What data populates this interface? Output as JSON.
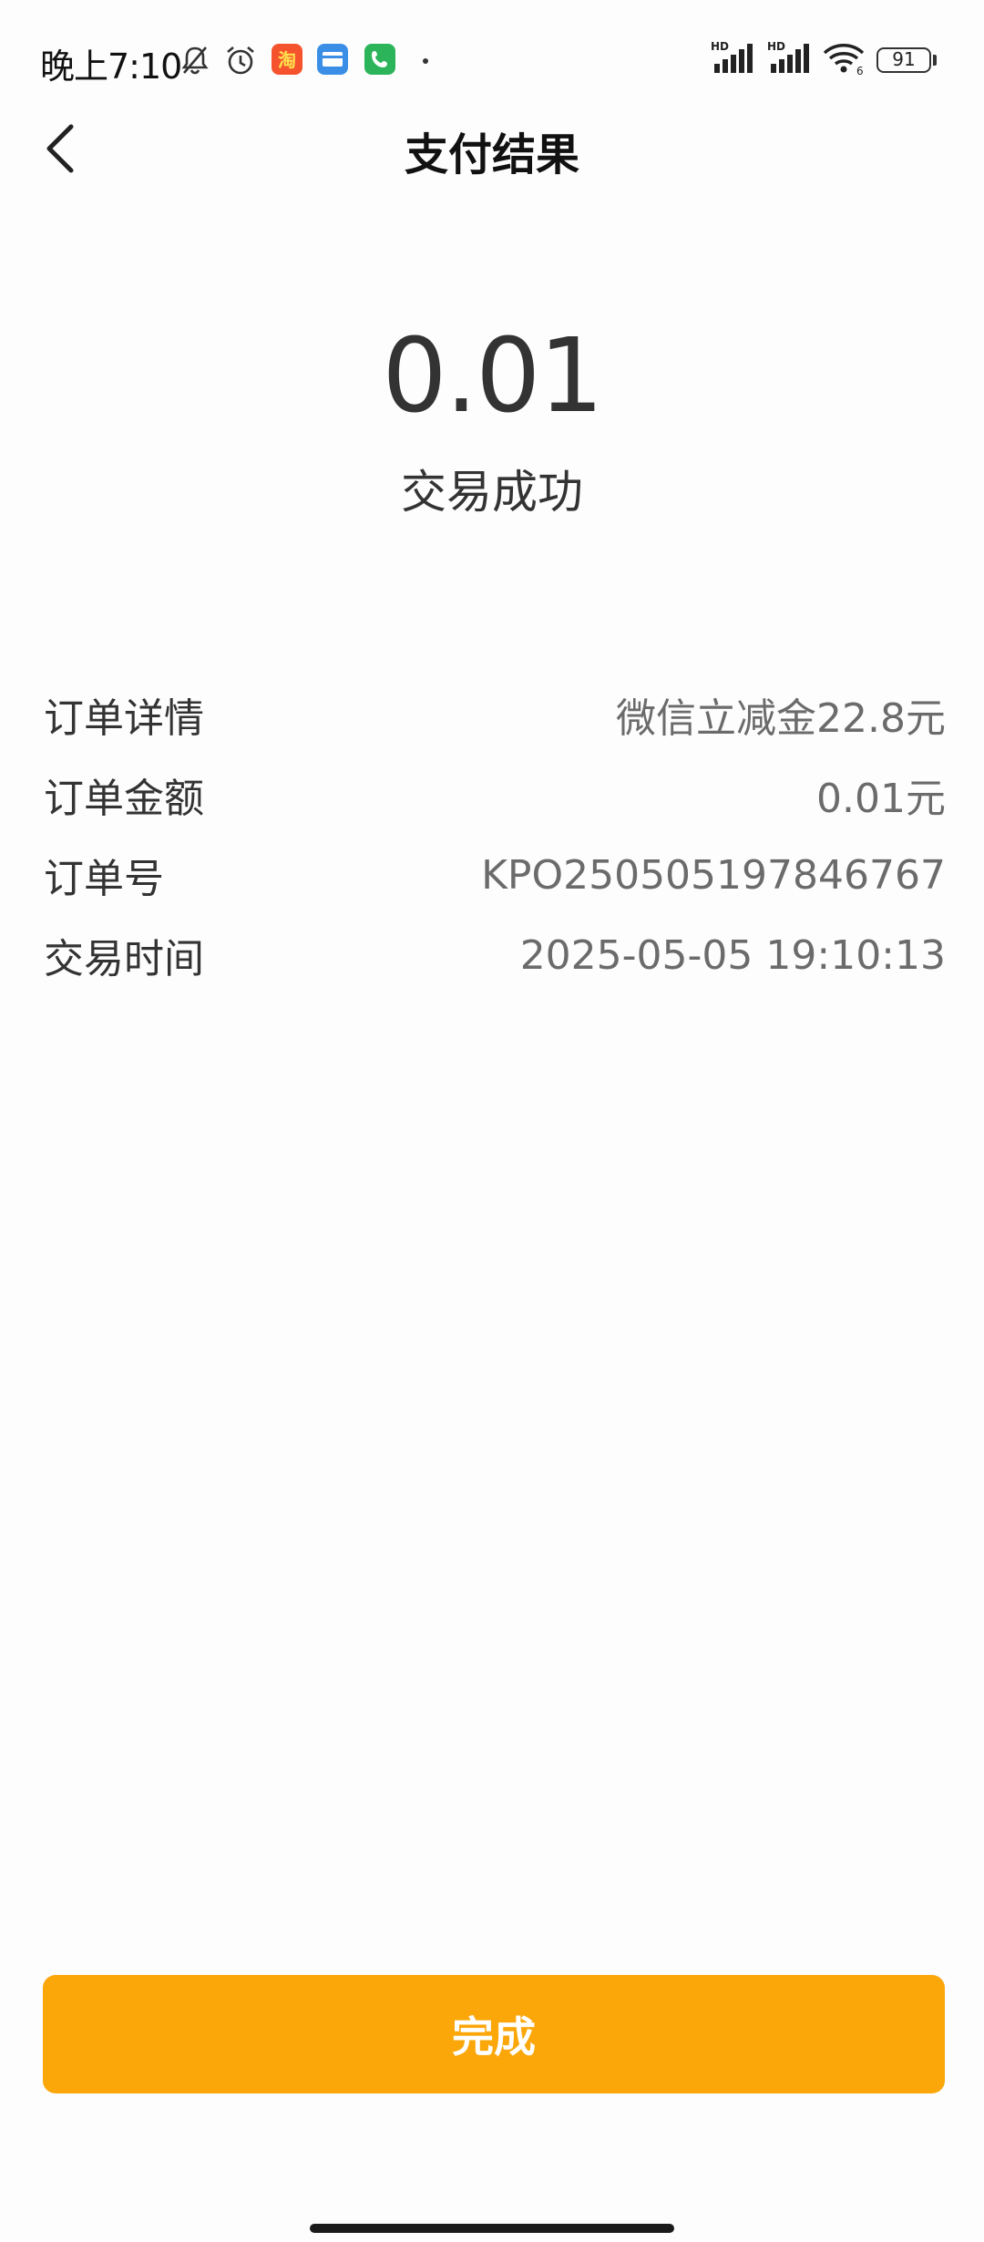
{
  "status_bar": {
    "time": "晚上7:10",
    "battery": "91",
    "icons": [
      "mute-bell-icon",
      "alarm-icon",
      "taobao-app-icon",
      "card-app-icon",
      "phone-app-icon",
      "signal-hd-icon",
      "signal-hd-icon",
      "wifi-icon",
      "battery-icon"
    ],
    "colors": {
      "taobao": "#f5532d",
      "card": "#3a8ee6",
      "phone": "#2bb45a"
    }
  },
  "header": {
    "title": "支付结果",
    "back_icon": "chevron-left-icon"
  },
  "result": {
    "amount": "0.01",
    "status": "交易成功"
  },
  "details": [
    {
      "label": "订单详情",
      "value": "微信立减金22.8元"
    },
    {
      "label": "订单金额",
      "value": "0.01元"
    },
    {
      "label": "订单号",
      "value": "KPO250505197846767"
    },
    {
      "label": "交易时间",
      "value": "2025-05-05 19:10:13"
    }
  ],
  "actions": {
    "done_label": "完成",
    "accent_color": "#fba70a"
  }
}
